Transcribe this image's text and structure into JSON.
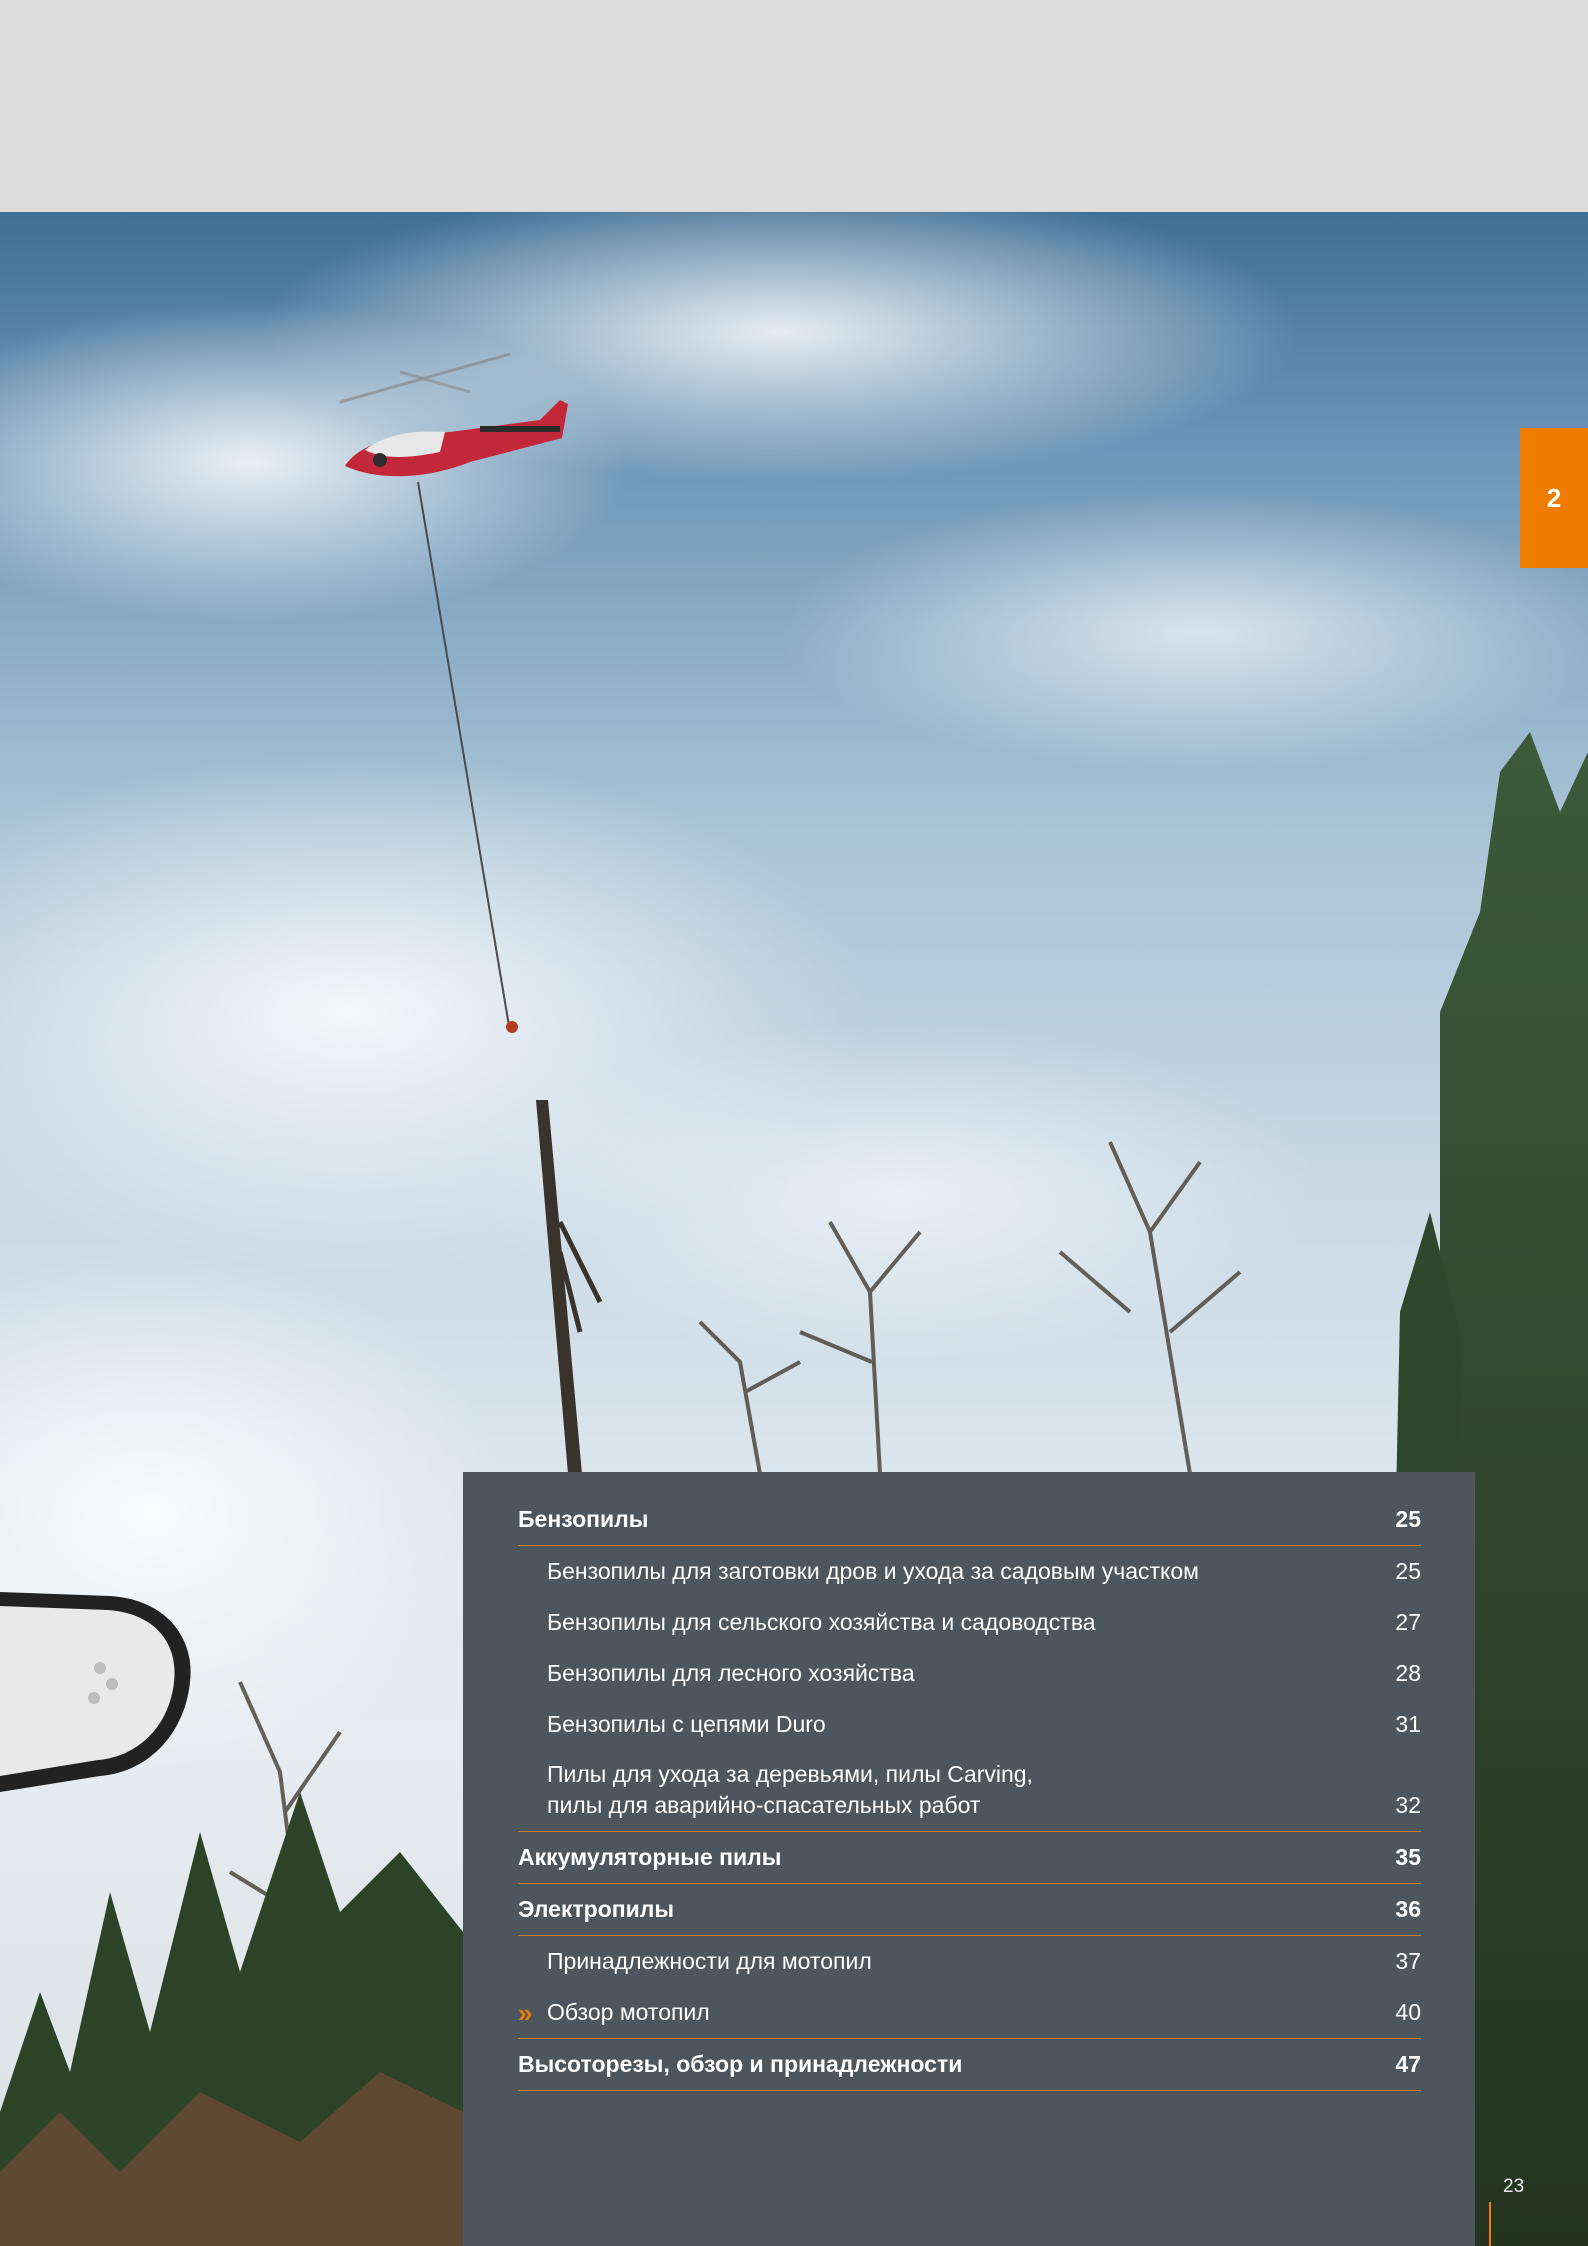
{
  "chapter_tab": {
    "label": "2"
  },
  "toc": [
    {
      "label": "Бензопилы",
      "page": "25",
      "kind": "major"
    },
    {
      "label": "Бензопилы для заготовки дров и ухода за садовым участком",
      "page": "25",
      "kind": "sub"
    },
    {
      "label": "Бензопилы для сельского хозяйства и садоводства",
      "page": "27",
      "kind": "sub"
    },
    {
      "label": "Бензопилы для лесного хозяйства",
      "page": "28",
      "kind": "sub"
    },
    {
      "label": "Бензопилы с цепями Duro",
      "page": "31",
      "kind": "sub"
    },
    {
      "label": "Пилы для ухода за деревьями, пилы Carving, пилы для аварийно-спасательных работ",
      "page": "32",
      "kind": "sub"
    },
    {
      "label": "Аккумуляторные пилы",
      "page": "35",
      "kind": "major"
    },
    {
      "label": "Электропилы",
      "page": "36",
      "kind": "major"
    },
    {
      "label": "Принадлежности для мотопил",
      "page": "37",
      "kind": "sub"
    },
    {
      "label": "Обзор мотопил",
      "page": "40",
      "kind": "sub",
      "marker": "»"
    },
    {
      "label": "Высоторезы, обзор и принадлежности",
      "page": "47",
      "kind": "major"
    }
  ],
  "page_number": "23",
  "colors": {
    "accent": "#f07c00",
    "panel": "#4c565c",
    "rule": "#c27a2b",
    "top_band": "#dcdcdc"
  }
}
